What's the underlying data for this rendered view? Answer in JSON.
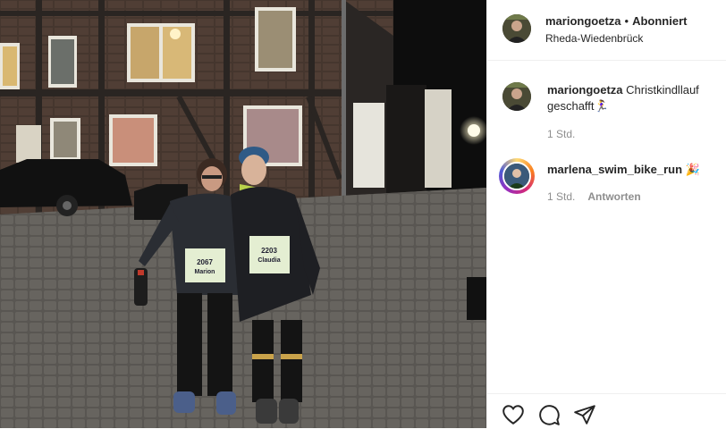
{
  "post": {
    "username": "mariongoetza",
    "separator": "•",
    "follow_status": "Abonniert",
    "location": "Rheda-Wiedenbrück"
  },
  "comments": [
    {
      "username": "mariongoetza",
      "text": "Christkindllauf geschafft",
      "emoji": "🏃‍♀️",
      "time": "1 Std."
    },
    {
      "username": "marlena_swim_bike_run",
      "emoji": "🎉",
      "time": "1 Std.",
      "reply_label": "Antworten"
    }
  ],
  "photo": {
    "bibs": [
      {
        "number": "2067",
        "name": "Marion"
      },
      {
        "number": "2203",
        "name": "Claudia"
      }
    ]
  },
  "icons": {
    "like": "heart-icon",
    "comment": "comment-bubble-icon",
    "share": "paper-plane-icon"
  }
}
